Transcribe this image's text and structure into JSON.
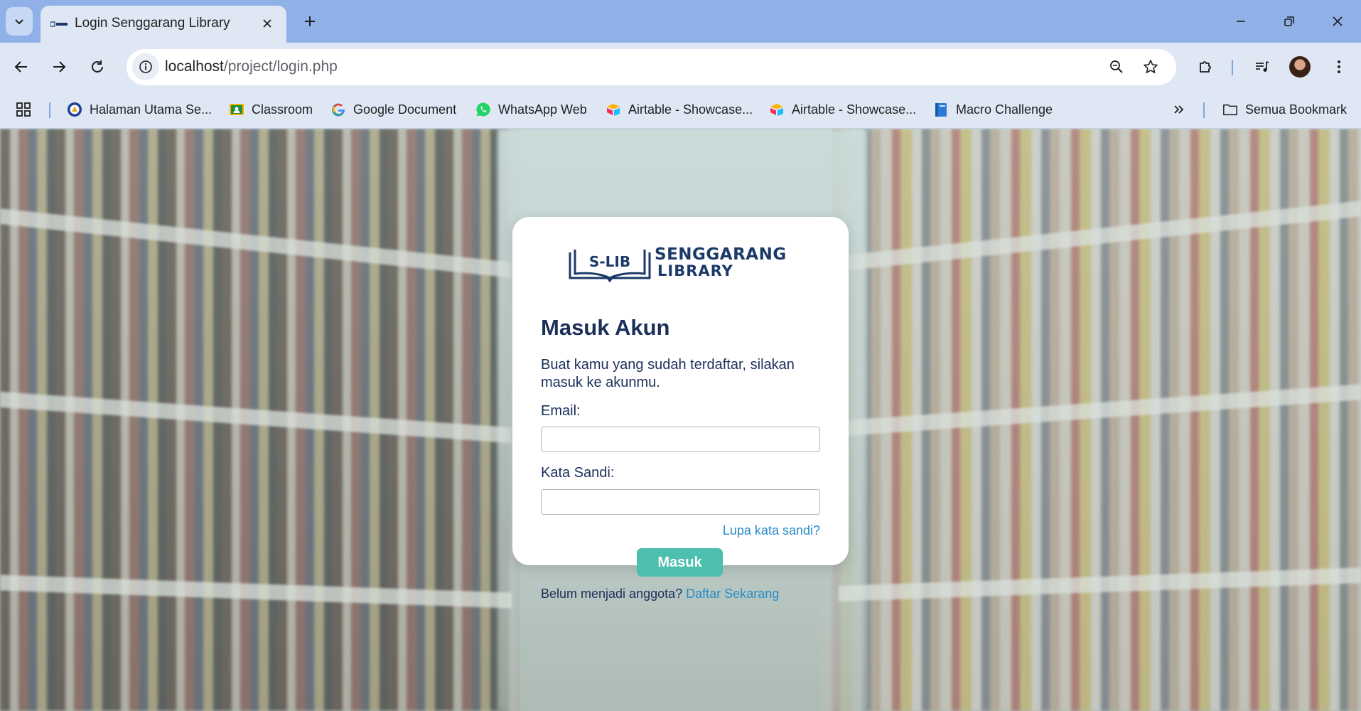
{
  "browser": {
    "tab": {
      "title": "Login Senggarang Library"
    },
    "address": {
      "host": "localhost",
      "path": "/project/login.php"
    },
    "bookmarks": [
      {
        "label": "Halaman Utama Se...",
        "icon": "circle-logo-icon"
      },
      {
        "label": "Classroom",
        "icon": "classroom-icon"
      },
      {
        "label": "Google Document",
        "icon": "google-g-icon"
      },
      {
        "label": "WhatsApp Web",
        "icon": "whatsapp-icon"
      },
      {
        "label": "Airtable - Showcase...",
        "icon": "airtable-icon"
      },
      {
        "label": "Airtable - Showcase...",
        "icon": "airtable-icon"
      },
      {
        "label": "Macro Challenge",
        "icon": "book-icon"
      }
    ],
    "all_bookmarks_label": "Semua Bookmark"
  },
  "logo": {
    "mark": "S-LIB",
    "line1": "SENGGARANG",
    "line2": "LIBRARY"
  },
  "login": {
    "title": "Masuk Akun",
    "subtitle": "Buat kamu yang sudah terdaftar, silakan masuk ke akunmu.",
    "email_label": "Email:",
    "password_label": "Kata Sandi:",
    "forgot_link": "Lupa kata sandi?",
    "submit_label": "Masuk",
    "register_prompt": "Belum menjadi anggota?",
    "register_link": "Daftar Sekarang"
  },
  "colors": {
    "accent": "#4dbfae",
    "link": "#2a8bc7",
    "heading": "#1a2f5a",
    "browser_frame": "#8fb1e8"
  }
}
